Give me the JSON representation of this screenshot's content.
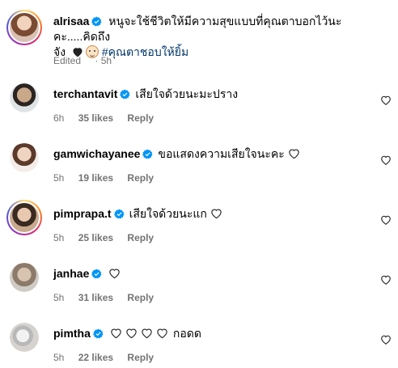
{
  "caption": {
    "username": "alrisaa",
    "text_line1": "หนูจะใช้ชีวิตให้มีความสุขแบบที่คุณตาบอกไว้นะคะ.....คิดถึง",
    "text_line2": "จัง",
    "hashtag": "#คุณตาชอบให้ยิ้ม",
    "edited": "Edited",
    "time": "5h"
  },
  "comments": [
    {
      "username": "terchantavit",
      "text": "เสียใจด้วยนะมะปราง",
      "time": "6h",
      "likes": "35 likes",
      "reply": "Reply",
      "heart": false
    },
    {
      "username": "gamwichayanee",
      "text": "ขอแสดงความเสียใจนะคะ",
      "time": "5h",
      "likes": "19 likes",
      "reply": "Reply",
      "heart": true
    },
    {
      "username": "pimprapa.t",
      "text": "เสียใจด้วยนะแก",
      "time": "5h",
      "likes": "25 likes",
      "reply": "Reply",
      "heart": true
    },
    {
      "username": "janhae",
      "text": "",
      "time": "5h",
      "likes": "31 likes",
      "reply": "Reply",
      "heart": true
    },
    {
      "username": "pimtha",
      "text": "",
      "time": "5h",
      "likes": "22 likes",
      "reply": "Reply",
      "hearts_count": 4,
      "after_text": "กอดด"
    }
  ],
  "icons": {
    "verified": "verified-badge-icon",
    "like": "heart-outline-icon",
    "black_heart": "black-heart-emoji",
    "face": "old-man-emoji"
  },
  "colors": {
    "verified": "#0095f6",
    "meta": "#737373",
    "hashtag": "#00376b"
  }
}
